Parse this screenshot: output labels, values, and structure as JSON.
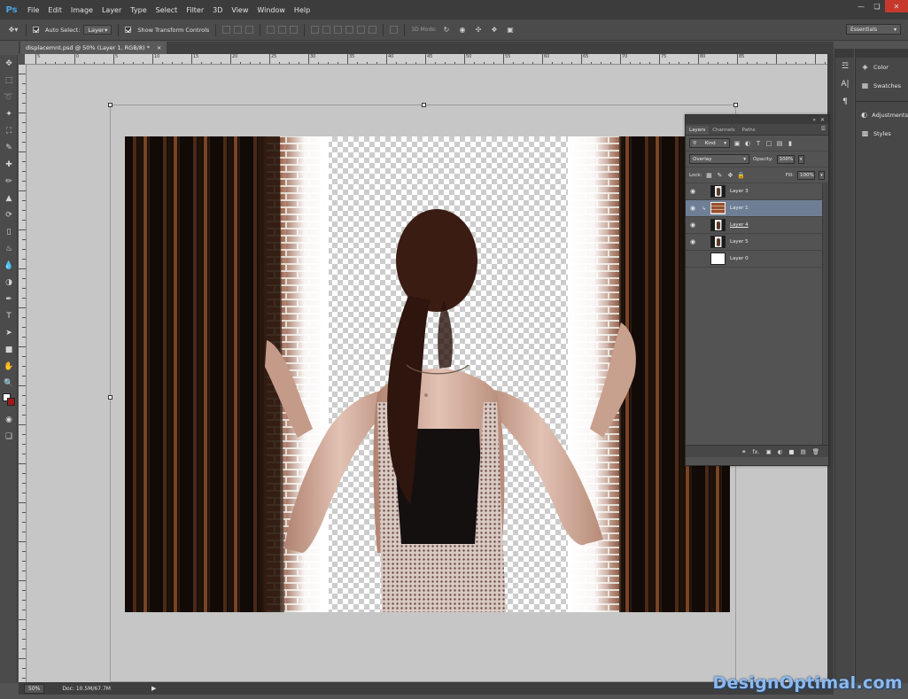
{
  "app": {
    "logo": "Ps"
  },
  "menu": [
    "File",
    "Edit",
    "Image",
    "Layer",
    "Type",
    "Select",
    "Filter",
    "3D",
    "View",
    "Window",
    "Help"
  ],
  "options": {
    "auto_select_label": "Auto Select:",
    "auto_select_value": "Layer",
    "show_transform_label": "Show Transform Controls",
    "mode_3d_label": "3D Mode:",
    "workspace": "Essentials"
  },
  "document": {
    "tab_title": "displacemnt.psd @ 50% (Layer 1, RGB/8) *",
    "tab_close": "×",
    "zoom": "50%",
    "doc_size": "Doc: 10.5M/67.7M"
  },
  "ruler_numbers": [
    "5",
    "0",
    "5",
    "10",
    "15",
    "20",
    "25",
    "30",
    "35",
    "40",
    "45",
    "50",
    "55",
    "60",
    "65",
    "70",
    "75",
    "80",
    "85"
  ],
  "dock": {
    "items": [
      {
        "label": "Color",
        "icon": "color-icon"
      },
      {
        "label": "Swatches",
        "icon": "swatches-icon"
      },
      {
        "label": "Adjustments",
        "icon": "adjustments-icon"
      },
      {
        "label": "Styles",
        "icon": "styles-icon"
      }
    ]
  },
  "layers_panel": {
    "tabs": [
      "Layers",
      "Channels",
      "Paths"
    ],
    "filter_kind": "Kind",
    "blend_mode": "Overlay",
    "opacity_label": "Opacity:",
    "opacity_value": "100%",
    "lock_label": "Lock:",
    "fill_label": "Fill:",
    "fill_value": "100%",
    "layers": [
      {
        "name": "Layer 3",
        "visible": true,
        "selected": false
      },
      {
        "name": "Layer 1",
        "visible": true,
        "selected": true
      },
      {
        "name": "Layer 4",
        "visible": true,
        "selected": false
      },
      {
        "name": "Layer 5",
        "visible": true,
        "selected": false
      },
      {
        "name": "Layer 0",
        "visible": false,
        "selected": false
      }
    ]
  },
  "watermark": "DesignOptimal.com"
}
